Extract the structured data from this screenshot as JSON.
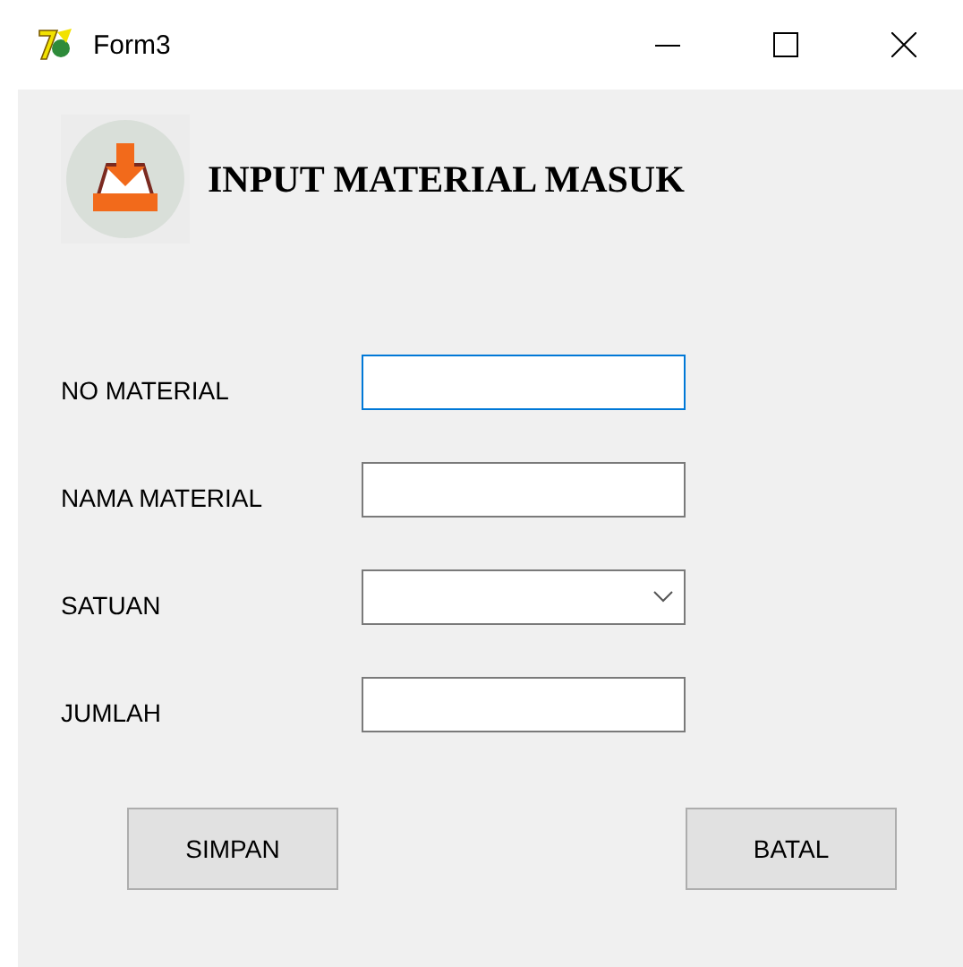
{
  "window": {
    "title": "Form3"
  },
  "heading": "INPUT MATERIAL MASUK",
  "fields": [
    {
      "label": "NO MATERIAL",
      "kind": "text",
      "focused": true
    },
    {
      "label": "NAMA MATERIAL",
      "kind": "text",
      "focused": false
    },
    {
      "label": "SATUAN",
      "kind": "select",
      "focused": false
    },
    {
      "label": "JUMLAH",
      "kind": "text",
      "focused": false
    }
  ],
  "buttons": [
    "SIMPAN",
    "BATAL"
  ]
}
